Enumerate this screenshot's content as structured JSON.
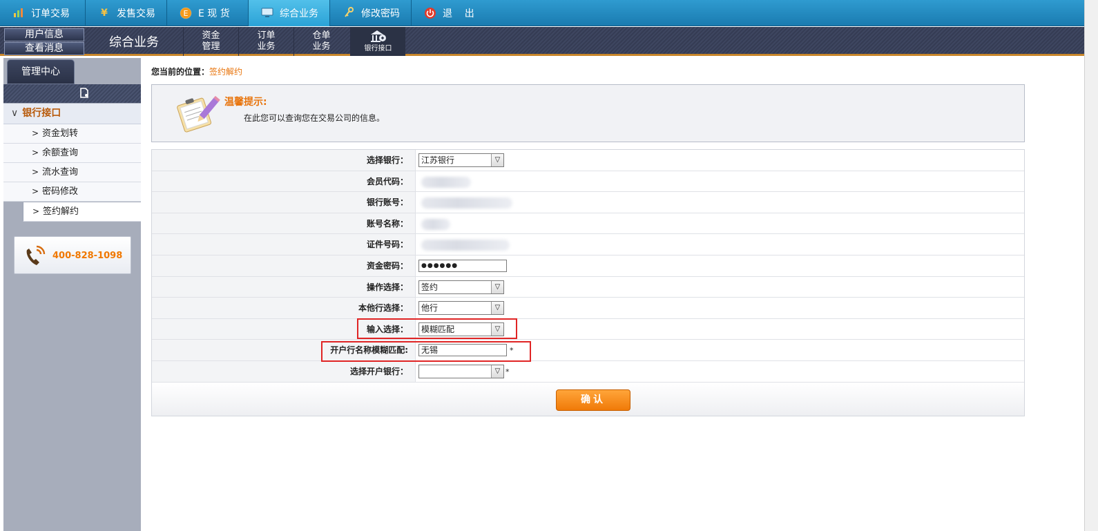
{
  "topnav": [
    {
      "label": "订单交易",
      "icon": "chart-icon"
    },
    {
      "label": "发售交易",
      "icon": "yen-icon"
    },
    {
      "label": "E 现 货",
      "icon": "e-coin-icon"
    },
    {
      "label": "综合业务",
      "icon": "monitor-icon",
      "active": true
    },
    {
      "label": "修改密码",
      "icon": "key-icon"
    },
    {
      "label": "退    出",
      "icon": "power-icon"
    }
  ],
  "subnav": {
    "user_info": "用户信息",
    "view_msg": "查看消息",
    "title": "综合业务",
    "items": [
      {
        "line1": "资金",
        "line2": "管理"
      },
      {
        "line1": "订单",
        "line2": "业务"
      },
      {
        "line1": "仓单",
        "line2": "业务"
      },
      {
        "line1": "",
        "line2": "银行接口",
        "active": true
      }
    ]
  },
  "sidebar": {
    "tab": "管理中心",
    "group": "银行接口",
    "items": [
      "资金划转",
      "余额查询",
      "流水查询",
      "密码修改",
      "签约解约"
    ],
    "active_index": 4,
    "phone": "400-828-1098"
  },
  "breadcrumb": {
    "prefix": "您当前的位置：",
    "current": "签约解约"
  },
  "tip": {
    "title": "温馨提示:",
    "text": "在此您可以查询您在交易公司的信息。"
  },
  "form": {
    "bank": {
      "label": "选择银行：",
      "value": "江苏银行"
    },
    "member_code": {
      "label": "会员代码："
    },
    "bank_account": {
      "label": "银行账号："
    },
    "account_name": {
      "label": "账号名称："
    },
    "id_number": {
      "label": "证件号码："
    },
    "fund_password": {
      "label": "资金密码：",
      "value": "●●●●●●"
    },
    "operation": {
      "label": "操作选择：",
      "value": "签约"
    },
    "bank_scope": {
      "label": "本他行选择：",
      "value": "他行"
    },
    "input_mode": {
      "label": "输入选择：",
      "value": "模糊匹配"
    },
    "branch_fuzzy": {
      "label": "开户行名称模糊匹配:",
      "value": "无锡"
    },
    "branch_bank": {
      "label": "选择开户银行：",
      "value": ""
    },
    "required_mark": "*",
    "confirm": "确认"
  },
  "colors": {
    "accent": "#e8740c",
    "nav": "#1a7bb0",
    "highlight": "#e02424"
  }
}
